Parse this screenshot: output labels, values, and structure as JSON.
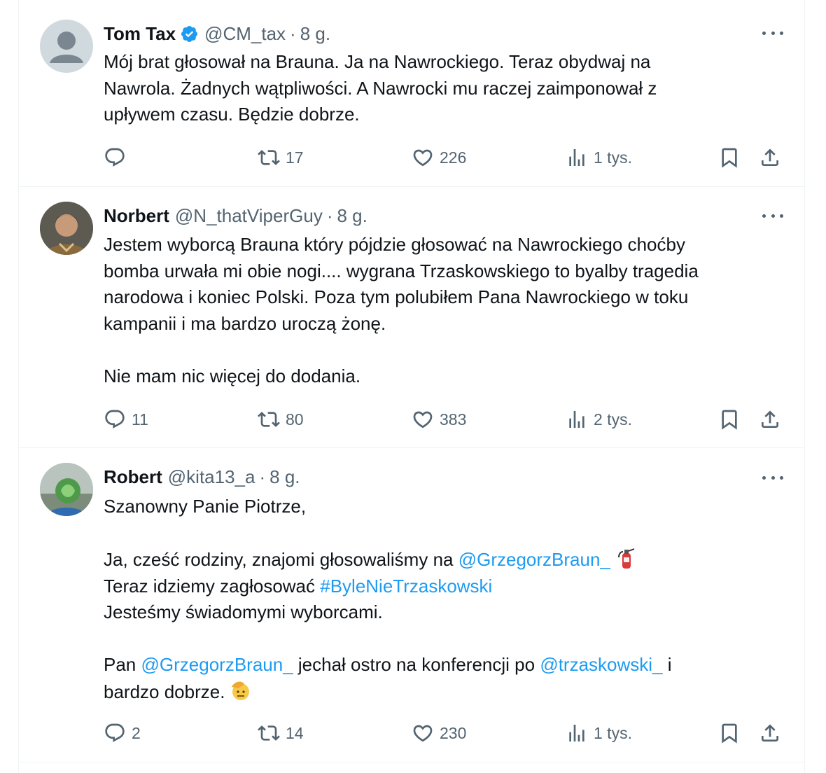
{
  "tweets": [
    {
      "name": "Tom Tax",
      "verified": true,
      "handle": "@CM_tax",
      "sep": "·",
      "time": "8 g.",
      "lines": [
        "Mój brat głosował na Brauna. Ja na Nawrockiego. Teraz obydwaj na",
        "Nawrola. Żadnych wątpliwości. A Nawrocki mu raczej zaimponował z",
        "upływem czasu. Będzie dobrze."
      ],
      "replies": "",
      "reposts": "17",
      "likes": "226",
      "views": "1 tys."
    },
    {
      "name": "Norbert",
      "handle": "@N_thatViperGuy",
      "sep": "·",
      "time": "8 g.",
      "lines": [
        "Jestem wyborcą Brauna który pójdzie głosować na Nawrockiego choćby",
        "bomba urwała mi obie nogi.... wygrana Trzaskowskiego to byalby tragedia",
        "narodowa i koniec Polski. Poza tym polubiłem Pana Nawrockiego w toku",
        "kampanii i ma bardzo uroczą żonę.",
        "",
        "Nie mam nic więcej do dodania."
      ],
      "replies": "11",
      "reposts": "80",
      "likes": "383",
      "views": "2 tys."
    },
    {
      "name": "Robert",
      "handle": "@kita13_a",
      "sep": "·",
      "time": "8 g.",
      "line1": "Szanowny Panie Piotrze,",
      "line3_text": "Ja, cześć rodziny, znajomi głosowaliśmy na ",
      "line3_mention": "@GrzegorzBraun_",
      "line4_text": "Teraz idziemy zagłosować ",
      "line4_hashtag": "#ByleNieTrzaskowski",
      "line5": "Jesteśmy świadomymi wyborcami.",
      "line7_a": "Pan ",
      "line7_mention1": "@GrzegorzBraun_",
      "line7_b": " jechał ostro na konferencji po ",
      "line7_mention2": "@trzaskowski_",
      "line7_c": " i",
      "line8": "bardzo dobrze.",
      "emoji1": "fire-extinguisher-emoji",
      "emoji2": "saluting-face-emoji",
      "replies": "2",
      "reposts": "14",
      "likes": "230",
      "views": "1 tys."
    }
  ],
  "colors": {
    "text": "#0f1419",
    "muted": "#536471",
    "link": "#1d9bf0",
    "verified": "#1d9bf0",
    "divider": "#eff3f4"
  }
}
